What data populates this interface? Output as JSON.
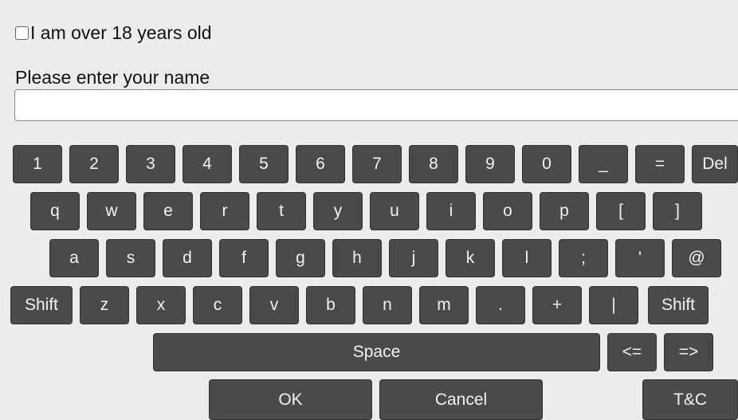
{
  "age_checkbox": {
    "label": "I am over 18 years old",
    "checked": false
  },
  "name_field": {
    "label": "Please enter your name",
    "value": ""
  },
  "keyboard": {
    "row1": [
      "1",
      "2",
      "3",
      "4",
      "5",
      "6",
      "7",
      "8",
      "9",
      "0",
      "_",
      "=",
      "Del"
    ],
    "row2": [
      "q",
      "w",
      "e",
      "r",
      "t",
      "y",
      "u",
      "i",
      "o",
      "p",
      "[",
      "]"
    ],
    "row3": [
      "a",
      "s",
      "d",
      "f",
      "g",
      "h",
      "j",
      "k",
      "l",
      ";",
      "'",
      "@"
    ],
    "row4": [
      "Shift",
      "z",
      "x",
      "c",
      "v",
      "b",
      "n",
      "m",
      ".",
      "+",
      "|",
      "Shift"
    ],
    "row5": [
      "Space",
      "<=",
      "=>"
    ],
    "row6": [
      "OK",
      "Cancel",
      "T&C"
    ]
  },
  "colors": {
    "key_background": "#4a4a4a",
    "key_text": "#f2f2f2",
    "page_background": "#ececec"
  }
}
